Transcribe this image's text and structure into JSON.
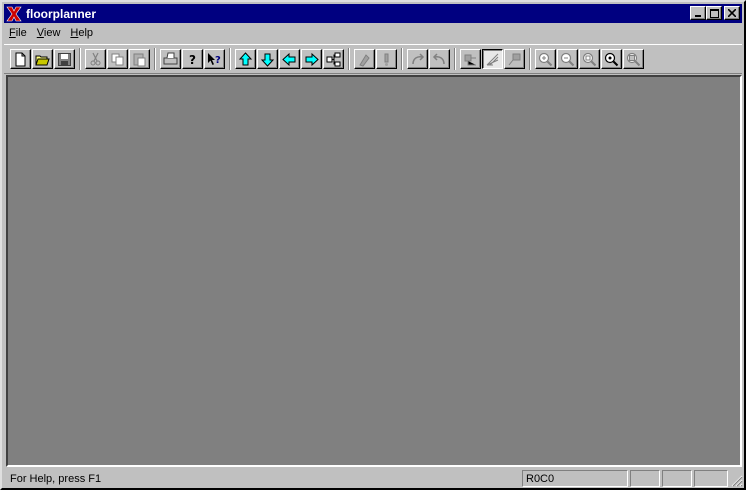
{
  "window": {
    "title": "floorplanner"
  },
  "caption_buttons": {
    "minimize": "_",
    "maximize": "□",
    "close": "×"
  },
  "menu": [
    {
      "label": "File",
      "mnemonic": "F",
      "rest": "ile"
    },
    {
      "label": "View",
      "mnemonic": "V",
      "rest": "iew"
    },
    {
      "label": "Help",
      "mnemonic": "H",
      "rest": "elp"
    }
  ],
  "toolbar": {
    "buttons": [
      "new-file-icon",
      "open-folder-icon",
      "save-icon",
      "cut-icon",
      "copy-icon",
      "paste-icon",
      "print-icon",
      "help-icon",
      "context-help-icon",
      "move-up-icon",
      "move-down-icon",
      "move-left-icon",
      "move-right-icon",
      "hierarchy-icon",
      "place-icon",
      "unplace-icon",
      "undo-icon",
      "redo-icon",
      "route-icon",
      "ratsnest-icon",
      "flightline-icon",
      "zoom-in-icon",
      "zoom-out-icon",
      "zoom-fit-icon",
      "zoom-select-icon",
      "zoom-full-icon"
    ],
    "pressed": "ratsnest-icon"
  },
  "status": {
    "help_text": "For Help, press F1",
    "position": "R0C0",
    "pane3": "",
    "pane4": "",
    "pane5": ""
  },
  "colors": {
    "title_bar": "#000080",
    "client_area": "#808080",
    "face": "#c0c0c0",
    "arrow_fill": "#00ffff",
    "logo": "#cc0000"
  }
}
